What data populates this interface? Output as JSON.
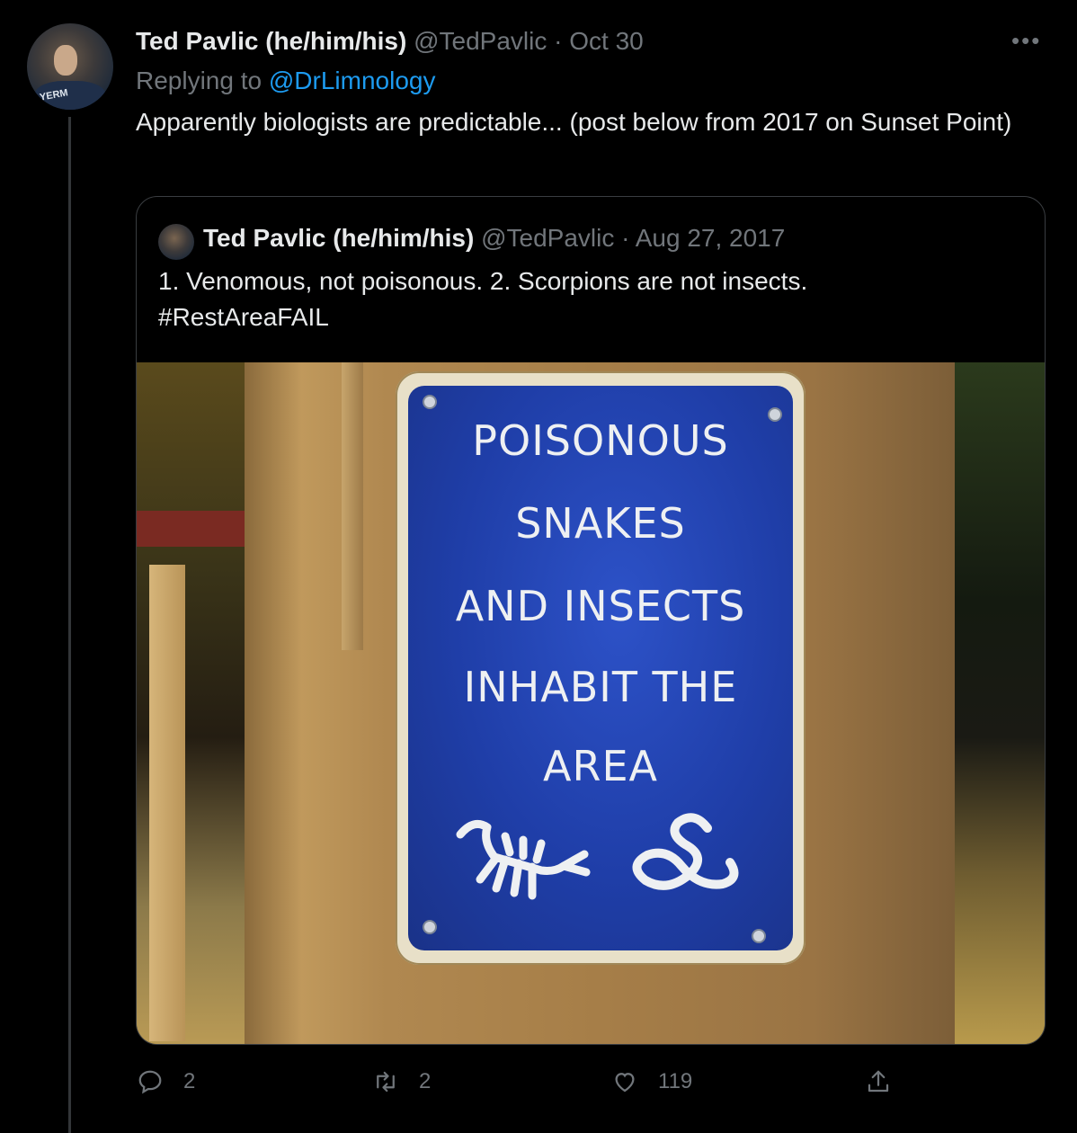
{
  "reply_tweet": {
    "author_name": "Ted Pavlic (he/him/his)",
    "handle": "@TedPavlic",
    "separator": "·",
    "timestamp": "Oct 30",
    "more_icon": "more-horizontal-icon",
    "replying_prefix": "Replying to",
    "replying_to": "@DrLimnology",
    "text": "Apparently biologists are predictable... (post below from 2017 on Sunset Point)"
  },
  "quoted_tweet": {
    "author_name": "Ted Pavlic (he/him/his)",
    "handle": "@TedPavlic",
    "separator": "·",
    "timestamp": "Aug 27, 2017",
    "text_line1": "1. Venomous, not poisonous. 2. Scorpions are not insects.",
    "text_line2": "#RestAreaFAIL",
    "image": {
      "sign_lines": [
        "POISONOUS",
        "SNAKES",
        "AND INSECTS",
        "INHABIT THE",
        "AREA"
      ],
      "sign_colors": {
        "sign_blue": "#1f3ea8",
        "sign_text": "#eef0f2"
      }
    }
  },
  "actions": {
    "reply_count": "2",
    "retweet_count": "2",
    "like_count": "119",
    "icons": [
      "reply-icon",
      "retweet-icon",
      "like-icon",
      "share-icon"
    ]
  },
  "colors": {
    "background": "#000000",
    "text": "#e7e9ea",
    "muted": "#71767b",
    "link": "#1d9bf0"
  }
}
